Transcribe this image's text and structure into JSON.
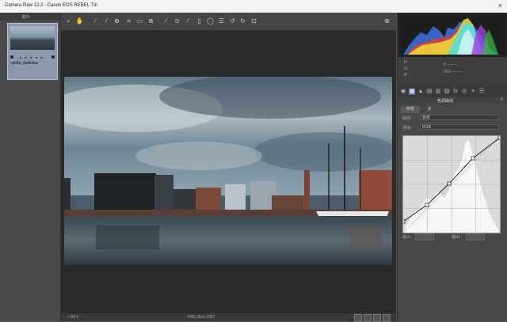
{
  "window": {
    "title": "Camera Raw 12.2  -  Canon EOS REBEL T3i",
    "close_icon": "×"
  },
  "filmstrip": {
    "title": "胶片",
    "thumbnail": {
      "filename": "qei8a_dsdkdsa",
      "stars": "★ ★ ★ ★ ★"
    }
  },
  "toolbar": {
    "tools": [
      "zoom-tool-icon",
      "hand-tool-icon",
      "white-balance-icon",
      "color-sampler-icon",
      "target-adjust-icon",
      "crop-icon",
      "straighten-icon",
      "transform-icon",
      "spot-removal-icon",
      "red-eye-icon",
      "adjustment-brush-icon",
      "graduated-filter-icon",
      "radial-filter-icon",
      "preferences-icon",
      "rotate-ccw-icon",
      "rotate-cw-icon",
      "trash-icon"
    ],
    "fullscreen_icon": "fullscreen-icon"
  },
  "status": {
    "zoom": "□ 89  ▾",
    "filename": "IMG_8xxx.CR2"
  },
  "panel": {
    "camera_info": {
      "line1": "f/ ---     ---- ",
      "line2": "ISO ---   ----"
    },
    "section_title": "色调曲线",
    "curve_tabs": [
      "参数",
      "点"
    ],
    "curve_label": "曲线:",
    "curve_value": "自定",
    "channel_label": "通道:",
    "channel_value": "RGB",
    "input_label": "输入:",
    "output_label": "输出:"
  },
  "colors": {
    "accent": "#5b7bc0",
    "panel_bg": "#474747",
    "main_bg": "#2a2a2a"
  }
}
